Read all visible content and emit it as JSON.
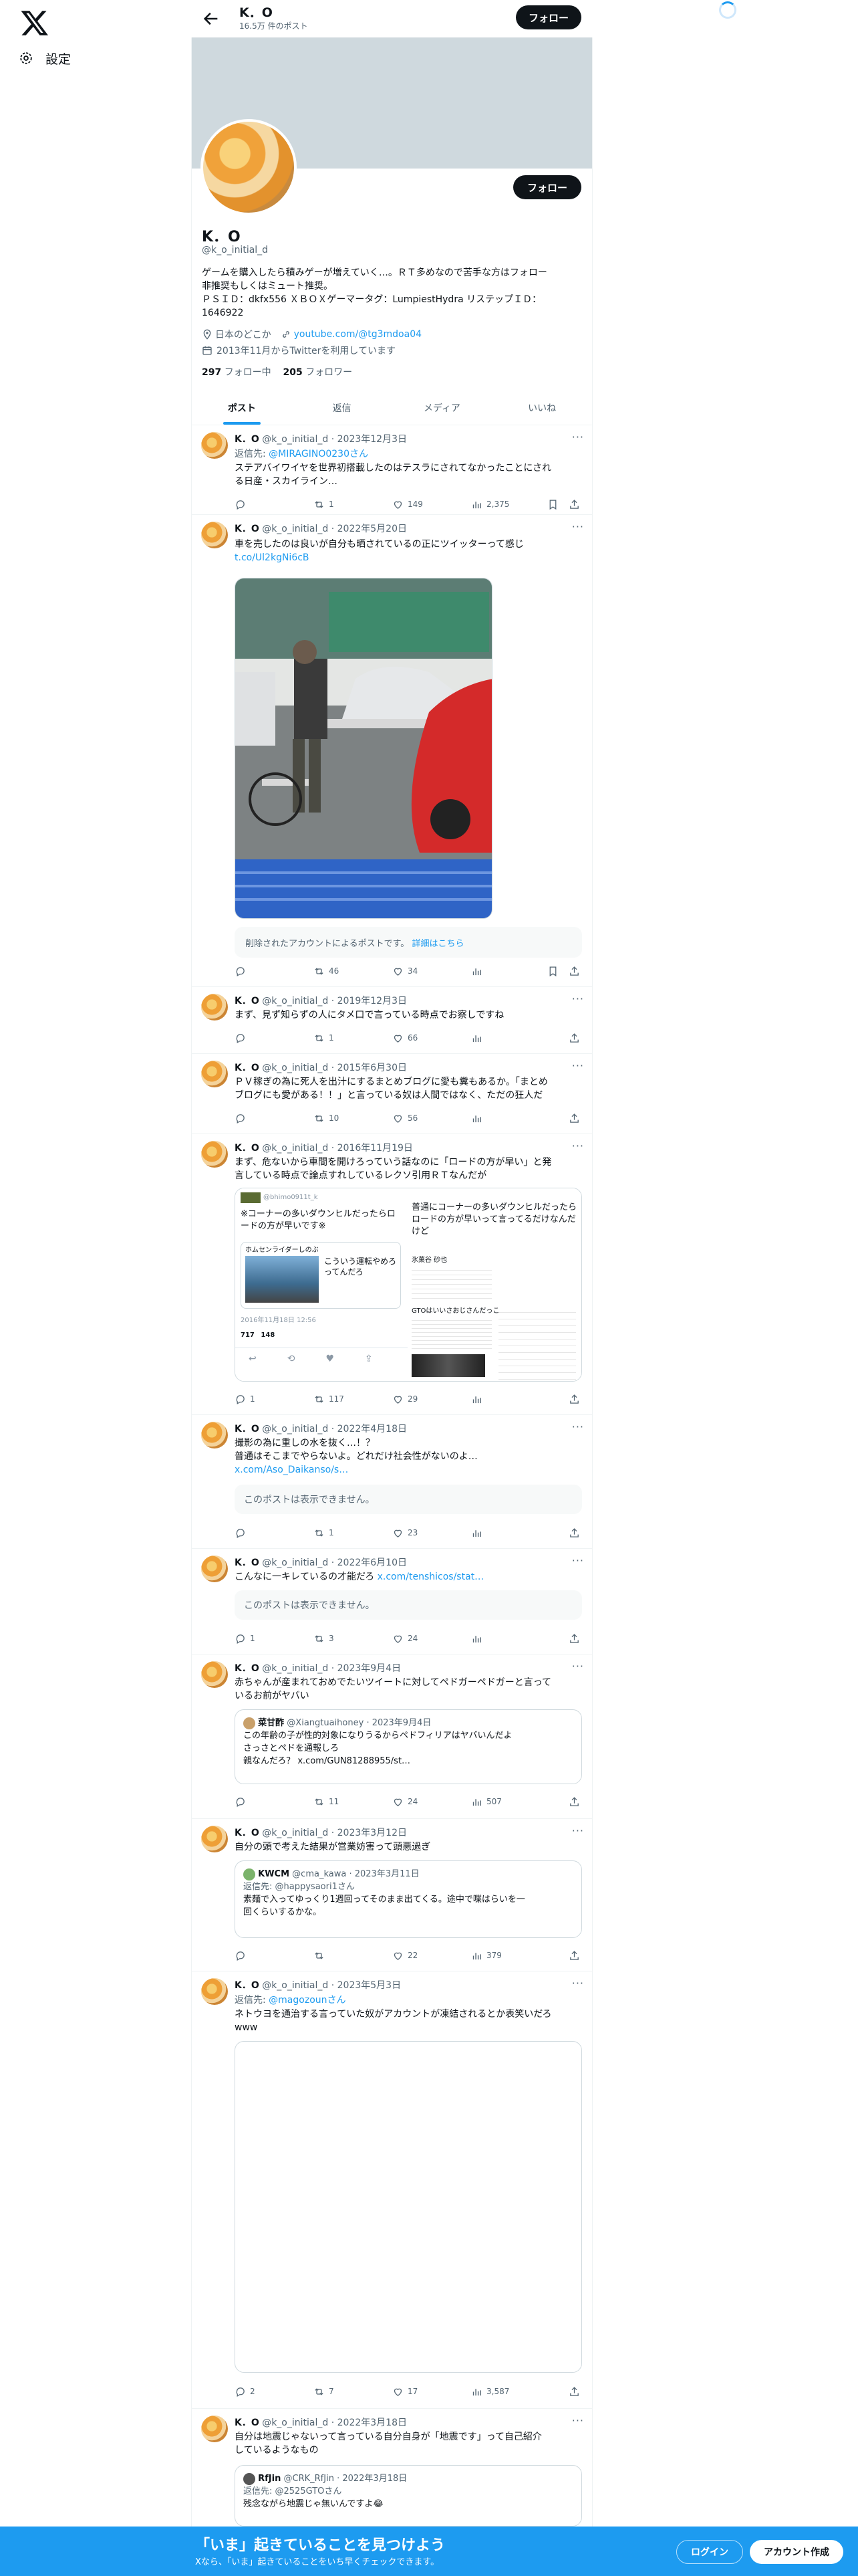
{
  "nav": {
    "settings_label": "設定"
  },
  "header": {
    "name": "K．O",
    "post_count": "16.5万 件のポスト",
    "follow_label": "フォロー"
  },
  "profile": {
    "name": "K．O",
    "handle": "@k_o_initial_d",
    "follow_label": "フォロー",
    "bio_1": "ゲームを購入したら積みゲーが増えていく…。ＲＴ多めなので苦手な方はフォロー",
    "bio_2": "非推奨もしくはミュート推奨。",
    "bio_3": "ＰＳＩＤ：dkfx556 ＸＢＯＸゲーマータグ：LumpiestHydra リステップＩＤ：",
    "bio_4": "1646922",
    "location": "日本のどこか",
    "website": "youtube.com/@tg3mdoa04",
    "joined": "2013年11月からTwitterを利用しています",
    "following_count": "297",
    "following_label": "フォロー中",
    "followers_count": "205",
    "followers_label": "フォロワー"
  },
  "tabs": [
    "ポスト",
    "返信",
    "メディア",
    "いいね"
  ],
  "tweets": [
    {
      "name": "K．O",
      "handle": "@k_o_initial_d",
      "date": "2023年12月3日",
      "reply_label": "返信先: ",
      "reply_to": "@MIRAGINO0230さん",
      "text_1": "ステアバイワイヤを世界初搭載したのはテスラにされてなかったことにされ",
      "text_2": "る日産・スカイライン…",
      "reply": "",
      "retweet": "1",
      "like": "149",
      "views": "2,375"
    },
    {
      "name": "K．O",
      "handle": "@k_o_initial_d",
      "date": "2022年5月20日",
      "text_1": "車を売したのは良いが自分も晒されているの正にツイッターって感じ",
      "link": "t.co/Ul2kgNi6cB",
      "deleted_note": "削除されたアカウントによるポストです。",
      "deleted_link": "詳細はこちら",
      "reply": "",
      "retweet": "46",
      "like": "34",
      "views": ""
    },
    {
      "name": "K．O",
      "handle": "@k_o_initial_d",
      "date": "2019年12月3日",
      "text_1": "まず、見ず知らずの人にタメ口で言っている時点でお察しですね",
      "reply": "",
      "retweet": "1",
      "like": "66",
      "views": ""
    },
    {
      "name": "K．O",
      "handle": "@k_o_initial_d",
      "date": "2015年6月30日",
      "text_1": "ＰＶ稼ぎの為に死人を出汁にするまとめブログに愛も糞もあるか。「まとめ",
      "text_2": "ブログにも愛がある！！」と言っている奴は人間ではなく、ただの狂人だ",
      "reply": "",
      "retweet": "10",
      "like": "56",
      "views": ""
    },
    {
      "name": "K．O",
      "handle": "@k_o_initial_d",
      "date": "2016年11月19日",
      "text_1": "まず、危ないから車間を開けろっていう話なのに「ロードの方が早い」と発",
      "text_2": "言している時点で論点すれしているレクソ引用ＲＴなんだが",
      "img_left_handle": "@bhimo0911t_k",
      "img_left_text": "※コーナーの多いダウンヒルだったらロードの方が早いです※",
      "img_left_card": "こういう運転やめろってんだろ",
      "img_left_name": "ホムセンライダーしのぶ",
      "img_left_date": "2016年11月18日 12:56",
      "img_left_rt": "717",
      "img_left_like": "148",
      "img_right_text": "普通にコーナーの多いダウンヒルだったらロードの方が早いって言ってるだけなんだけど",
      "img_right_name": "氷菓谷 砂也",
      "img_right_name2": "GTOはいいさおじさんだっころ",
      "reply": "1",
      "retweet": "117",
      "like": "29",
      "views": ""
    },
    {
      "name": "K．O",
      "handle": "@k_o_initial_d",
      "date": "2022年4月18日",
      "text_1": "撮影の為に重しの水を抜く…！？",
      "text_2": "普通はそこまでやらないよ。どれだけ社会性がないのよ…",
      "link": "x.com/Aso_Daikanso/s…",
      "unavailable": "このポストは表示できません。",
      "reply": "",
      "retweet": "1",
      "like": "23",
      "views": ""
    },
    {
      "name": "K．O",
      "handle": "@k_o_initial_d",
      "date": "2022年6月10日",
      "text_1": "こんなに一キレているの才能だろ",
      "link": "x.com/tenshicos/stat…",
      "unavailable": "このポストは表示できません。",
      "reply": "1",
      "retweet": "3",
      "like": "24",
      "views": ""
    },
    {
      "name": "K．O",
      "handle": "@k_o_initial_d",
      "date": "2023年9月4日",
      "text_1": "赤ちゃんが産まれておめでたいツイートに対してペドガーペドガーと言って",
      "text_2": "いるお前がヤバい",
      "q_name": "菜甘酢",
      "q_handle": "@Xiangtuaihoney",
      "q_date": "2023年9月4日",
      "q_text_1": "この年齢の子が性的対象になりうるからペドフィリアはヤバいんだよ",
      "q_text_2": "さっさとペドを通報しろ",
      "q_text_3": "親なんだろ？ x.com/GUN81288955/st…",
      "reply": "",
      "retweet": "11",
      "like": "24",
      "views": "507"
    },
    {
      "name": "K．O",
      "handle": "@k_o_initial_d",
      "date": "2023年3月12日",
      "text_1": "自分の頭で考えた結果が営業妨害って頭悪過ぎ",
      "q_name": "KWCM",
      "q_handle": "@cma_kawa",
      "q_date": "2023年3月11日",
      "q_reply": "返信先: @happysaori1さん",
      "q_text_1": "素麺で入ってゆっくり1週回ってそのまま出てくる。途中で喋はらいを一",
      "q_text_2": "回くらいするかな。",
      "reply": "",
      "retweet": "",
      "like": "22",
      "views": "379"
    },
    {
      "name": "K．O",
      "handle": "@k_o_initial_d",
      "date": "2023年5月3日",
      "reply_label": "返信先: ",
      "reply_to": "@magozounさん",
      "text_1": "ネトウヨを通治する言っていた奴がアカウントが凍結されるとか表笑いだろ",
      "text_2": "www",
      "reply": "2",
      "retweet": "7",
      "like": "17",
      "views": "3,587"
    },
    {
      "name": "K．O",
      "handle": "@k_o_initial_d",
      "date": "2022年3月18日",
      "text_1": "自分は地震じゃないって言っている自分自身が「地震です」って自己紹介",
      "text_2": "しているようなもの",
      "q_name": "RfJin",
      "q_handle": "@CRK_RfJin",
      "q_date": "2022年3月18日",
      "q_reply": "返信先: @2525GTOさん",
      "q_text_1": "残念ながら地震じゃ無いんですよ😂"
    }
  ],
  "bottom": {
    "title": "「いま」起きていることを見つけよう",
    "subtitle": "Xなら、「いま」起きていることをいち早くチェックできます。",
    "login": "ログイン",
    "signup": "アカウント作成"
  },
  "colors": {
    "accent": "#1d9bf0",
    "text": "#0f1419",
    "muted": "#536471",
    "border": "#eff3f4"
  }
}
